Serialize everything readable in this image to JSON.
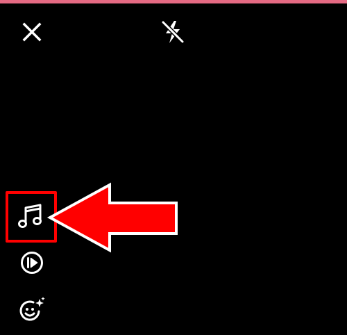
{
  "colors": {
    "background": "#000000",
    "icon": "#ffffff",
    "top_accent": "#e56a83",
    "highlight": "#ff0000",
    "arrow_fill": "#ff0000",
    "arrow_stroke": "#ffffff"
  },
  "top_bar": {
    "close_icon": "close-icon",
    "flash_icon": "flash-off-icon"
  },
  "side_toolbar": {
    "items": [
      {
        "icon": "music-note-icon",
        "highlighted": true
      },
      {
        "icon": "play-speed-icon",
        "highlighted": false
      },
      {
        "icon": "face-effects-icon",
        "highlighted": false
      }
    ]
  },
  "annotation": {
    "type": "arrow",
    "direction": "left",
    "target": "music-note-icon"
  }
}
